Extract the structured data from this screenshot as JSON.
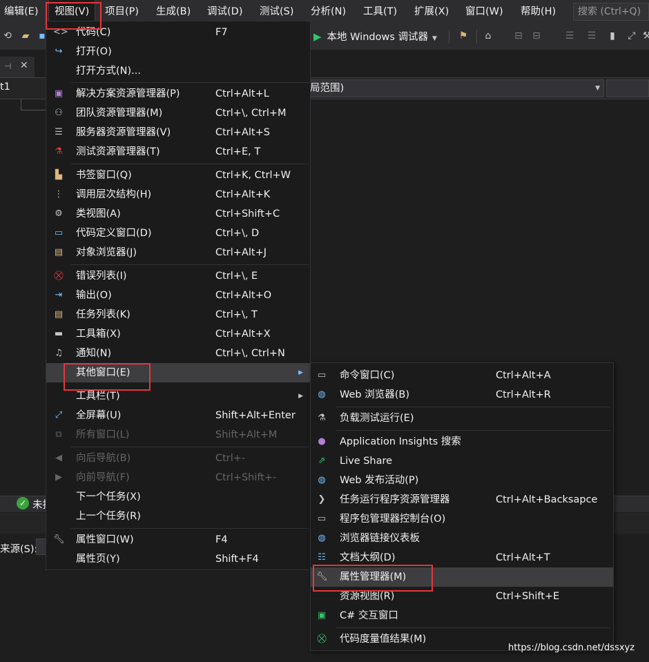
{
  "menubar": {
    "items": [
      "编辑(E)",
      "视图(V)",
      "项目(P)",
      "生成(B)",
      "调试(D)",
      "测试(S)",
      "分析(N)",
      "工具(T)",
      "扩展(X)",
      "窗口(W)",
      "帮助(H)"
    ],
    "active_item": "视图(V)",
    "search_placeholder": "搜索 (Ctrl+Q)"
  },
  "toolbar": {
    "run_label": "本地 Windows 调试器"
  },
  "editor": {
    "project_name": "t1",
    "scope_text": "局范围)",
    "status_text": "未找",
    "source_label": "来源(S):"
  },
  "view_menu": {
    "items": [
      {
        "icon": "code-icon",
        "label": "代码(C)",
        "shortcut": "F7",
        "enabled": true
      },
      {
        "icon": "open-icon",
        "label": "打开(O)",
        "shortcut": "",
        "enabled": true
      },
      {
        "icon": "",
        "label": "打开方式(N)...",
        "shortcut": "",
        "enabled": true
      },
      {
        "icon": "solution-explorer-icon",
        "label": "解决方案资源管理器(P)",
        "shortcut": "Ctrl+Alt+L",
        "enabled": true
      },
      {
        "icon": "team-explorer-icon",
        "label": "团队资源管理器(M)",
        "shortcut": "Ctrl+\\, Ctrl+M",
        "enabled": true
      },
      {
        "icon": "server-explorer-icon",
        "label": "服务器资源管理器(V)",
        "shortcut": "Ctrl+Alt+S",
        "enabled": true
      },
      {
        "icon": "test-explorer-icon",
        "label": "测试资源管理器(T)",
        "shortcut": "Ctrl+E, T",
        "enabled": true
      },
      {
        "icon": "bookmark-window-icon",
        "label": "书签窗口(Q)",
        "shortcut": "Ctrl+K, Ctrl+W",
        "enabled": true
      },
      {
        "icon": "call-hierarchy-icon",
        "label": "调用层次结构(H)",
        "shortcut": "Ctrl+Alt+K",
        "enabled": true
      },
      {
        "icon": "class-view-icon",
        "label": "类视图(A)",
        "shortcut": "Ctrl+Shift+C",
        "enabled": true
      },
      {
        "icon": "code-definition-icon",
        "label": "代码定义窗口(D)",
        "shortcut": "Ctrl+\\, D",
        "enabled": true
      },
      {
        "icon": "object-browser-icon",
        "label": "对象浏览器(J)",
        "shortcut": "Ctrl+Alt+J",
        "enabled": true
      },
      {
        "icon": "error-list-icon",
        "label": "错误列表(I)",
        "shortcut": "Ctrl+\\, E",
        "enabled": true
      },
      {
        "icon": "output-icon",
        "label": "输出(O)",
        "shortcut": "Ctrl+Alt+O",
        "enabled": true
      },
      {
        "icon": "task-list-icon",
        "label": "任务列表(K)",
        "shortcut": "Ctrl+\\, T",
        "enabled": true
      },
      {
        "icon": "toolbox-icon",
        "label": "工具箱(X)",
        "shortcut": "Ctrl+Alt+X",
        "enabled": true
      },
      {
        "icon": "bell-icon",
        "label": "通知(N)",
        "shortcut": "Ctrl+\\, Ctrl+N",
        "enabled": true
      },
      {
        "icon": "",
        "label": "其他窗口(E)",
        "shortcut": "",
        "enabled": true,
        "submenu": true,
        "highlighted": true
      },
      {
        "icon": "",
        "label": "工具栏(T)",
        "shortcut": "",
        "enabled": true,
        "submenu": true
      },
      {
        "icon": "fullscreen-icon",
        "label": "全屏幕(U)",
        "shortcut": "Shift+Alt+Enter",
        "enabled": true
      },
      {
        "icon": "all-windows-icon",
        "label": "所有窗口(L)",
        "shortcut": "Shift+Alt+M",
        "enabled": false
      },
      {
        "icon": "navigate-back-icon",
        "label": "向后导航(B)",
        "shortcut": "Ctrl+-",
        "enabled": false
      },
      {
        "icon": "navigate-forward-icon",
        "label": "向前导航(F)",
        "shortcut": "Ctrl+Shift+-",
        "enabled": false
      },
      {
        "icon": "",
        "label": "下一个任务(X)",
        "shortcut": "",
        "enabled": true
      },
      {
        "icon": "",
        "label": "上一个任务(R)",
        "shortcut": "",
        "enabled": true
      },
      {
        "icon": "wrench-icon",
        "label": "属性窗口(W)",
        "shortcut": "F4",
        "enabled": true
      },
      {
        "icon": "",
        "label": "属性页(Y)",
        "shortcut": "Shift+F4",
        "enabled": true
      }
    ]
  },
  "other_windows_menu": {
    "items": [
      {
        "icon": "command-window-icon",
        "label": "命令窗口(C)",
        "shortcut": "Ctrl+Alt+A"
      },
      {
        "icon": "globe-icon",
        "label": "Web 浏览器(B)",
        "shortcut": "Ctrl+Alt+R"
      },
      {
        "icon": "load-test-icon",
        "label": "负载测试运行(E)",
        "shortcut": ""
      },
      {
        "icon": "lightbulb-icon",
        "label": "Application Insights 搜索",
        "shortcut": ""
      },
      {
        "icon": "live-share-icon",
        "label": "Live Share",
        "shortcut": ""
      },
      {
        "icon": "web-publish-icon",
        "label": "Web 发布活动(P)",
        "shortcut": ""
      },
      {
        "icon": "chevron-right-icon",
        "label": "任务运行程序资源管理器",
        "shortcut": "Ctrl+Alt+Backsapce"
      },
      {
        "icon": "console-icon",
        "label": "程序包管理器控制台(O)",
        "shortcut": ""
      },
      {
        "icon": "browser-link-icon",
        "label": "浏览器链接仪表板",
        "shortcut": ""
      },
      {
        "icon": "document-outline-icon",
        "label": "文档大纲(D)",
        "shortcut": "Ctrl+Alt+T"
      },
      {
        "icon": "wrench-icon",
        "label": "属性管理器(M)",
        "shortcut": "",
        "highlighted": true
      },
      {
        "icon": "",
        "label": "资源视图(R)",
        "shortcut": "Ctrl+Shift+E"
      },
      {
        "icon": "csharp-interactive-icon",
        "label": "C# 交互窗口",
        "shortcut": ""
      },
      {
        "icon": "code-metrics-icon",
        "label": "代码度量值结果(M)",
        "shortcut": ""
      }
    ]
  },
  "colors": {
    "accent_red": "#e8363a",
    "run_green": "#36c36b",
    "menu_bg": "#1b1b1c",
    "highlight_bg": "#3e3e40"
  },
  "watermark": "https://blog.csdn.net/dssxyz"
}
